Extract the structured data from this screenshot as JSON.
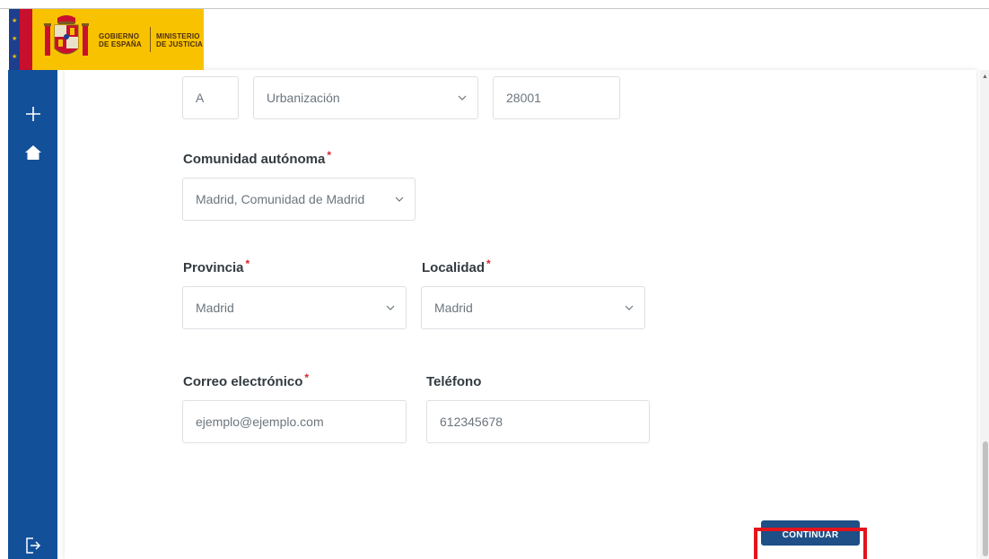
{
  "logo": {
    "line1a": "GOBIERNO",
    "line1b": "DE ESPAÑA",
    "line2a": "MINISTERIO",
    "line2b": "DE JUSTICIA"
  },
  "sidebar": {
    "items": [
      {
        "icon": "plus-icon"
      },
      {
        "icon": "home-icon"
      },
      {
        "icon": "logout-icon"
      }
    ]
  },
  "address": {
    "letter_value": "A",
    "via_type_value": "Urbanización",
    "postal_code_value": "28001"
  },
  "comunidad": {
    "label": "Comunidad autónoma",
    "required": "*",
    "value": "Madrid, Comunidad de Madrid"
  },
  "provincia": {
    "label": "Provincia",
    "required": "*",
    "value": "Madrid"
  },
  "localidad": {
    "label": "Localidad",
    "required": "*",
    "value": "Madrid"
  },
  "correo": {
    "label": "Correo electrónico",
    "required": "*",
    "placeholder": "ejemplo@ejemplo.com"
  },
  "telefono": {
    "label": "Teléfono",
    "placeholder": "612345678"
  },
  "actions": {
    "continue_label": "CONTINUAR"
  },
  "colors": {
    "sidebar": "#13509a",
    "button": "#1e4f86",
    "required": "#d9232e",
    "highlight": "#e3141c",
    "logo_bg": "#f8c200"
  }
}
